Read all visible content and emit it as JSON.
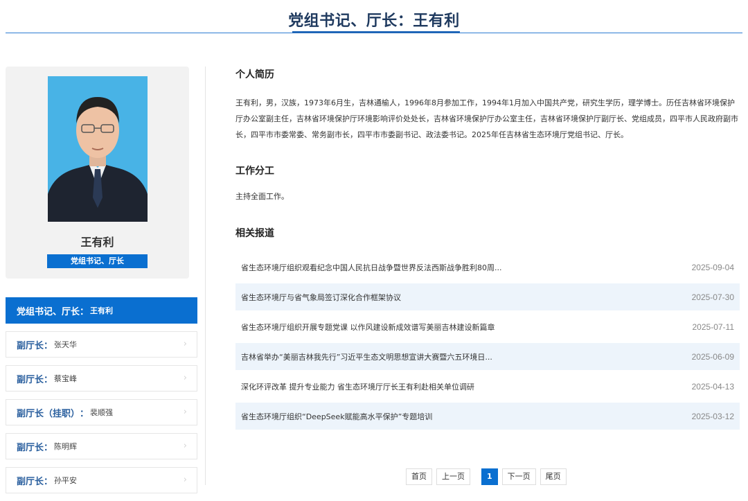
{
  "header": {
    "title": "党组书记、厅长：王有利"
  },
  "profile": {
    "name": "王有利",
    "title_tag": "党组书记、厅长"
  },
  "nav": [
    {
      "role": "党组书记、厅长",
      "name": "王有利",
      "active": true
    },
    {
      "role": "副厅长",
      "name": "张天华",
      "active": false
    },
    {
      "role": "副厅长",
      "name": "蔡宝峰",
      "active": false
    },
    {
      "role": "副厅长（挂职）",
      "name": "裴顺强",
      "active": false
    },
    {
      "role": "副厅长",
      "name": "陈明辉",
      "active": false
    },
    {
      "role": "副厅长",
      "name": "孙平安",
      "active": false
    }
  ],
  "nav_separator": "：",
  "nav_arrow": "›",
  "bio": {
    "heading": "个人简历",
    "text": "王有利，男，汉族，1973年6月生，吉林通榆人，1996年8月参加工作，1994年1月加入中国共产党，研究生学历，理学博士。历任吉林省环境保护厅办公室副主任，吉林省环境保护厅环境影响评价处处长，吉林省环境保护厅办公室主任，吉林省环境保护厅副厅长、党组成员，四平市人民政府副市长，四平市市委常委、常务副市长，四平市市委副书记、政法委书记。2025年任吉林省生态环境厅党组书记、厅长。"
  },
  "duty": {
    "heading": "工作分工",
    "text": "主持全面工作。"
  },
  "news": {
    "heading": "相关报道",
    "items": [
      {
        "title": "省生态环境厅组织观看纪念中国人民抗日战争暨世界反法西斯战争胜利80周...",
        "date": "2025-09-04"
      },
      {
        "title": "省生态环境厅与省气象局签订深化合作框架协议",
        "date": "2025-07-30"
      },
      {
        "title": "省生态环境厅组织开展专题党课 以作风建设新成效谱写美丽吉林建设新篇章",
        "date": "2025-07-11"
      },
      {
        "title": "吉林省举办“美丽吉林我先行”习近平生态文明思想宣讲大赛暨六五环境日...",
        "date": "2025-06-09"
      },
      {
        "title": "深化环评改革 提升专业能力 省生态环境厅厅长王有利赴相关单位调研",
        "date": "2025-04-13"
      },
      {
        "title": "省生态环境厅组织“DeepSeek赋能高水平保护”专题培训",
        "date": "2025-03-12"
      }
    ]
  },
  "pager": {
    "first": "首页",
    "prev": "上一页",
    "current": "1",
    "next": "下一页",
    "last": "尾页"
  },
  "colors": {
    "accent": "#0a6fd0",
    "heading": "#1f3a5f",
    "row_alt": "#edf4fb",
    "photo_bg": "#48b3e6"
  }
}
